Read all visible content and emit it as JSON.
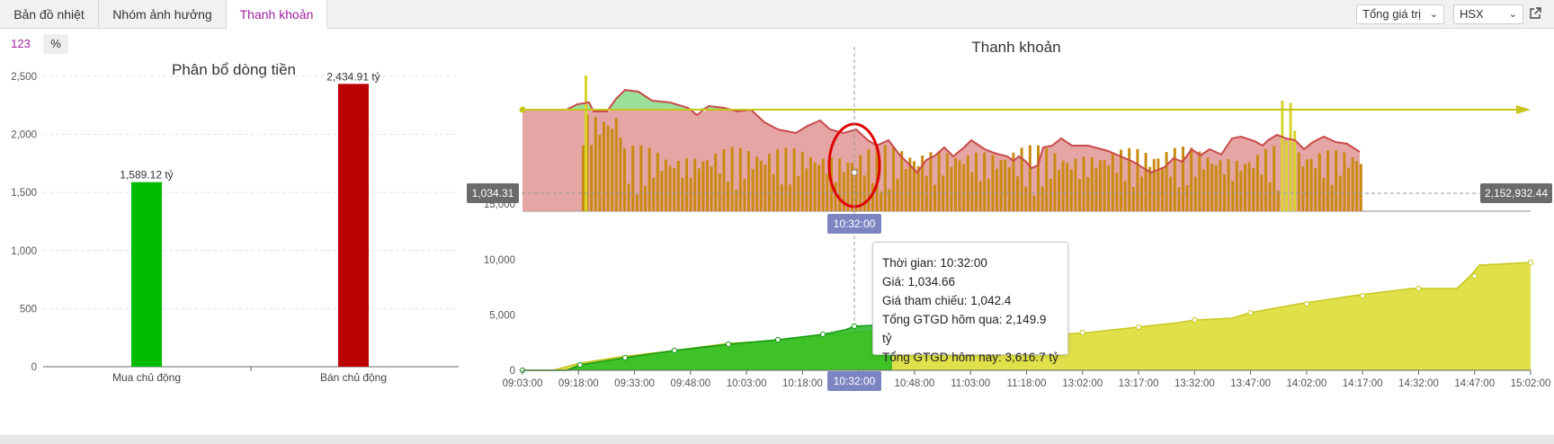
{
  "tabs": [
    {
      "label": "Bản đồ nhiệt"
    },
    {
      "label": "Nhóm ảnh hưởng"
    },
    {
      "label": "Thanh khoản",
      "active": true
    }
  ],
  "controls": {
    "value_type": "Tổng giá trị",
    "exchange": "HSX"
  },
  "unit_toggle": {
    "number": "123",
    "percent": "%"
  },
  "left_chart": {
    "chart_data": {
      "type": "bar",
      "title": "Phân bổ dòng tiền",
      "categories": [
        "Mua chủ động",
        "Bán chủ động"
      ],
      "values": [
        1589.12,
        2434.91
      ],
      "data_labels": [
        "1,589.12 tỷ",
        "2,434.91 tỷ"
      ],
      "colors": [
        "#00bb00",
        "#bb0000"
      ],
      "ylim": [
        0,
        2600
      ],
      "yticks": [
        "0",
        "500",
        "1,000",
        "1,500",
        "2,000",
        "2,500"
      ],
      "grid": true
    }
  },
  "right_chart": {
    "title": "Thanh khoản",
    "price_flag_left": "1,034.31",
    "volume_flag_right": "2,152,932.44",
    "time_flag": "10:32:00",
    "volume_axis_label": "15,000",
    "chart_data": {
      "type": "area",
      "title": "Thanh khoản",
      "x_ticks": [
        "09:03:00",
        "09:18:00",
        "09:33:00",
        "09:48:00",
        "10:03:00",
        "10:18:00",
        "10:32:00",
        "10:48:00",
        "11:03:00",
        "11:18:00",
        "13:02:00",
        "13:17:00",
        "13:32:00",
        "13:47:00",
        "14:02:00",
        "14:17:00",
        "14:32:00",
        "14:47:00",
        "15:02:00"
      ],
      "y_ticks_cumulative": [
        "0",
        "5,000",
        "10,000"
      ],
      "series": [
        {
          "name": "Tổng GTGD hôm nay",
          "color": "#22bb22",
          "values": [
            0,
            150,
            650,
            1150,
            1600,
            2050,
            2800,
            3616.7
          ]
        },
        {
          "name": "Tổng GTGD hôm qua",
          "color": "#d8d82a",
          "values": [
            0,
            200,
            600,
            1000,
            1450,
            1900,
            2350,
            2149.9,
            2700,
            3100,
            3500,
            4000,
            4650,
            5550,
            6500,
            7350,
            8100,
            10100,
            10200
          ]
        }
      ],
      "reference_price": 1042.4
    }
  },
  "tooltip": {
    "time": "Thời gian: 10:32:00",
    "price": "Giá: 1,034.66",
    "ref": "Giá tham chiếu: 1,042.4",
    "prev": "Tổng GTGD hôm qua: 2,149.9 tỷ",
    "today": "Tổng GTGD hôm nay: 3,616.7 tỷ"
  }
}
